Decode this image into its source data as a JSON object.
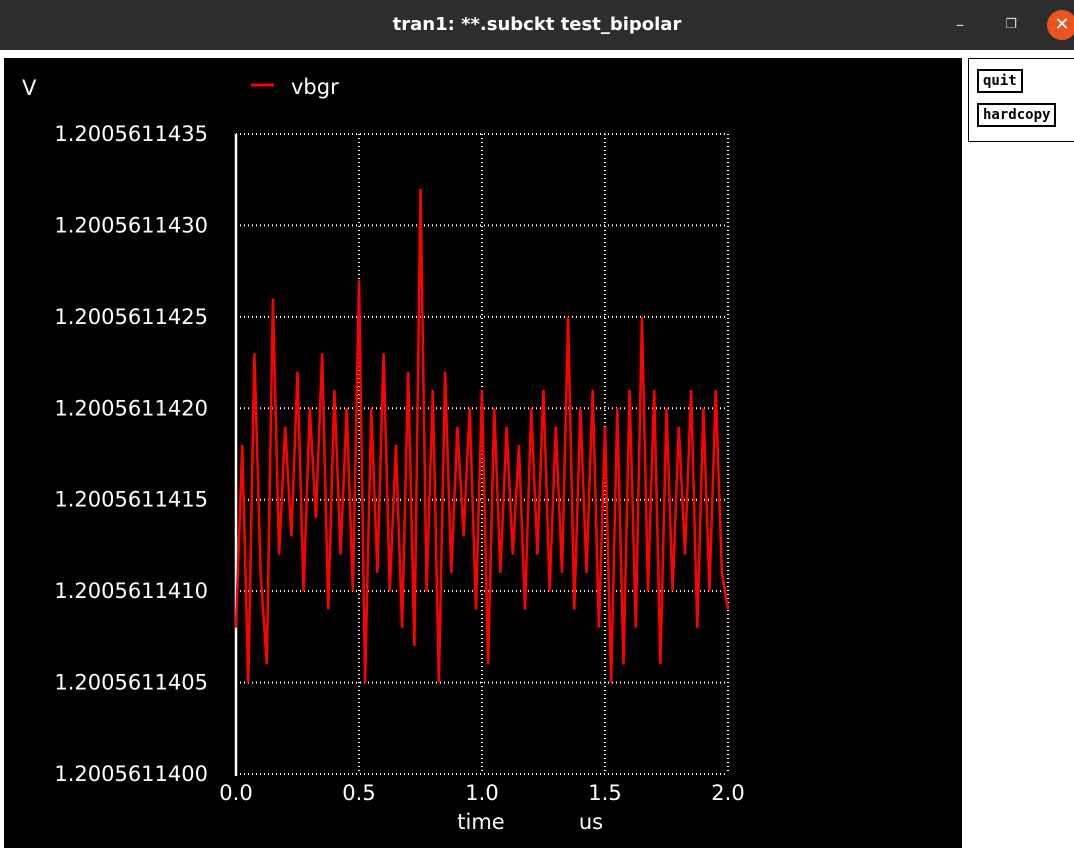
{
  "window": {
    "title": "tran1: **.subckt test_bipolar",
    "minimize_glyph": "–",
    "maximize_glyph": "❐",
    "close_glyph": "✕",
    "close_color": "#e95420"
  },
  "sidebar": {
    "quit_label": "quit",
    "hardcopy_label": "hardcopy"
  },
  "chart_data": {
    "type": "line",
    "ylabel": "V",
    "xlabel": "time",
    "xunit": "us",
    "legend_position": "top-left",
    "grid": true,
    "background": "#000000",
    "grid_color": "#ffffff",
    "xlim": [
      0.0,
      2.0
    ],
    "ylim": [
      1.20056114,
      1.2005611435
    ],
    "xticks": [
      "0.0",
      "0.5",
      "1.0",
      "1.5",
      "2.0"
    ],
    "yticks": [
      "1.2005611400",
      "1.2005611405",
      "1.2005611410",
      "1.2005611415",
      "1.2005611420",
      "1.2005611425",
      "1.2005611430",
      "1.2005611435"
    ],
    "series": [
      {
        "name": "vbgr",
        "color": "#ff0000",
        "x": [
          0.0,
          0.025,
          0.05,
          0.075,
          0.1,
          0.125,
          0.15,
          0.175,
          0.2,
          0.225,
          0.25,
          0.275,
          0.3,
          0.325,
          0.35,
          0.375,
          0.4,
          0.425,
          0.45,
          0.475,
          0.5,
          0.525,
          0.55,
          0.575,
          0.6,
          0.625,
          0.65,
          0.675,
          0.7,
          0.725,
          0.75,
          0.775,
          0.8,
          0.825,
          0.85,
          0.875,
          0.9,
          0.925,
          0.95,
          0.975,
          1.0,
          1.025,
          1.05,
          1.075,
          1.1,
          1.125,
          1.15,
          1.175,
          1.2,
          1.225,
          1.25,
          1.275,
          1.3,
          1.325,
          1.35,
          1.375,
          1.4,
          1.425,
          1.45,
          1.475,
          1.5,
          1.525,
          1.55,
          1.575,
          1.6,
          1.625,
          1.65,
          1.675,
          1.7,
          1.725,
          1.75,
          1.775,
          1.8,
          1.825,
          1.85,
          1.875,
          1.9,
          1.925,
          1.95,
          1.975,
          2.0
        ],
        "y": [
          1.2005611408,
          1.2005611418,
          1.2005611405,
          1.2005611423,
          1.2005611411,
          1.2005611406,
          1.2005611426,
          1.2005611412,
          1.2005611419,
          1.2005611413,
          1.2005611422,
          1.200561141,
          1.200561142,
          1.2005611414,
          1.2005611423,
          1.2005611409,
          1.2005611421,
          1.2005611412,
          1.200561142,
          1.200561141,
          1.2005611427,
          1.2005611405,
          1.200561142,
          1.2005611411,
          1.2005611423,
          1.200561141,
          1.2005611418,
          1.2005611408,
          1.2005611422,
          1.2005611407,
          1.2005611432,
          1.200561141,
          1.2005611421,
          1.2005611405,
          1.2005611422,
          1.2005611411,
          1.2005611419,
          1.2005611413,
          1.200561142,
          1.2005611409,
          1.2005611421,
          1.2005611406,
          1.200561142,
          1.2005611411,
          1.2005611419,
          1.2005611412,
          1.2005611418,
          1.2005611409,
          1.200561142,
          1.2005611412,
          1.2005611421,
          1.200561141,
          1.2005611419,
          1.2005611411,
          1.2005611425,
          1.2005611409,
          1.200561142,
          1.2005611411,
          1.2005611421,
          1.2005611408,
          1.2005611419,
          1.2005611405,
          1.200561142,
          1.2005611406,
          1.2005611421,
          1.2005611408,
          1.2005611425,
          1.200561141,
          1.2005611421,
          1.2005611406,
          1.200561142,
          1.200561141,
          1.2005611419,
          1.2005611412,
          1.2005611421,
          1.2005611408,
          1.200561142,
          1.200561141,
          1.2005611421,
          1.2005611411,
          1.2005611409
        ]
      }
    ]
  }
}
